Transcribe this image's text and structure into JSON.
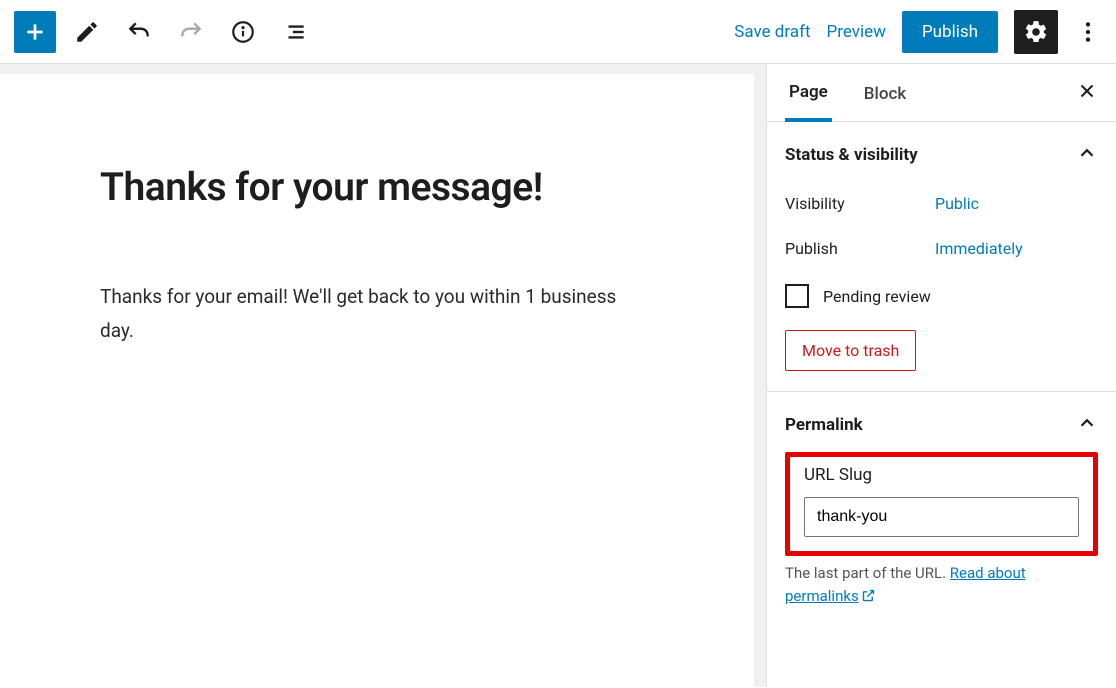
{
  "toolbar": {
    "save_draft": "Save draft",
    "preview": "Preview",
    "publish": "Publish"
  },
  "editor": {
    "title": "Thanks for your message!",
    "body": "Thanks for your email! We'll get back to you within 1 business day."
  },
  "sidebar": {
    "tabs": {
      "page": "Page",
      "block": "Block"
    },
    "status_panel": {
      "title": "Status & visibility",
      "visibility_label": "Visibility",
      "visibility_value": "Public",
      "publish_label": "Publish",
      "publish_value": "Immediately",
      "pending_review": "Pending review",
      "trash": "Move to trash"
    },
    "permalink_panel": {
      "title": "Permalink",
      "slug_label": "URL Slug",
      "slug_value": "thank-you",
      "helper_prefix": "The last part of the URL. ",
      "helper_link": "Read about permalinks"
    }
  },
  "colors": {
    "accent": "#007cba",
    "danger": "#cc1818",
    "highlight": "#e60000"
  }
}
